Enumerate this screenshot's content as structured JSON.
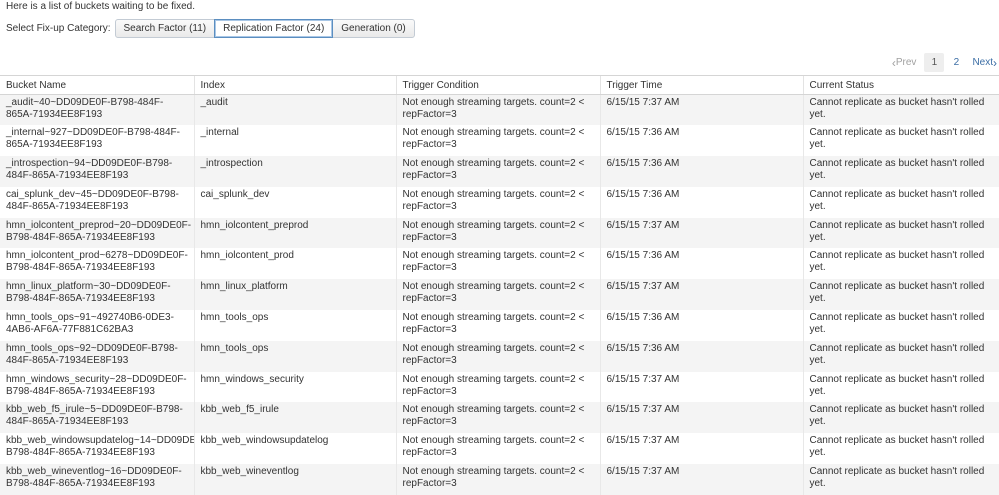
{
  "intro_text": "Here is a list of buckets waiting to be fixed.",
  "category": {
    "label": "Select Fix-up Category:",
    "buttons": [
      {
        "label": "Search Factor (11)",
        "active": false
      },
      {
        "label": "Replication Factor (24)",
        "active": true
      },
      {
        "label": "Generation (0)",
        "active": false
      }
    ]
  },
  "pagination": {
    "prev_label": "Prev",
    "pages": [
      "1",
      "2"
    ],
    "current_page": "1",
    "next_label": "Next"
  },
  "table": {
    "headers": [
      "Bucket Name",
      "Index",
      "Trigger Condition",
      "Trigger Time",
      "Current Status"
    ],
    "rows": [
      [
        "_audit~40~DD09DE0F-B798-484F-865A-71934EE8F193",
        "_audit",
        "Not enough streaming targets. count=2 < repFactor=3",
        "6/15/15 7:37 AM",
        "Cannot replicate as bucket hasn't rolled yet."
      ],
      [
        "_internal~927~DD09DE0F-B798-484F-865A-71934EE8F193",
        "_internal",
        "Not enough streaming targets. count=2 < repFactor=3",
        "6/15/15 7:36 AM",
        "Cannot replicate as bucket hasn't rolled yet."
      ],
      [
        "_introspection~94~DD09DE0F-B798-484F-865A-71934EE8F193",
        "_introspection",
        "Not enough streaming targets. count=2 < repFactor=3",
        "6/15/15 7:36 AM",
        "Cannot replicate as bucket hasn't rolled yet."
      ],
      [
        "cai_splunk_dev~45~DD09DE0F-B798-484F-865A-71934EE8F193",
        "cai_splunk_dev",
        "Not enough streaming targets. count=2 < repFactor=3",
        "6/15/15 7:36 AM",
        "Cannot replicate as bucket hasn't rolled yet."
      ],
      [
        "hmn_iolcontent_preprod~20~DD09DE0F-B798-484F-865A-71934EE8F193",
        "hmn_iolcontent_preprod",
        "Not enough streaming targets. count=2 < repFactor=3",
        "6/15/15 7:37 AM",
        "Cannot replicate as bucket hasn't rolled yet."
      ],
      [
        "hmn_iolcontent_prod~6278~DD09DE0F-B798-484F-865A-71934EE8F193",
        "hmn_iolcontent_prod",
        "Not enough streaming targets. count=2 < repFactor=3",
        "6/15/15 7:36 AM",
        "Cannot replicate as bucket hasn't rolled yet."
      ],
      [
        "hmn_linux_platform~30~DD09DE0F-B798-484F-865A-71934EE8F193",
        "hmn_linux_platform",
        "Not enough streaming targets. count=2 < repFactor=3",
        "6/15/15 7:37 AM",
        "Cannot replicate as bucket hasn't rolled yet."
      ],
      [
        "hmn_tools_ops~91~492740B6-0DE3-4AB6-AF6A-77F881C62BA3",
        "hmn_tools_ops",
        "Not enough streaming targets. count=2 < repFactor=3",
        "6/15/15 7:36 AM",
        "Cannot replicate as bucket hasn't rolled yet."
      ],
      [
        "hmn_tools_ops~92~DD09DE0F-B798-484F-865A-71934EE8F193",
        "hmn_tools_ops",
        "Not enough streaming targets. count=2 < repFactor=3",
        "6/15/15 7:36 AM",
        "Cannot replicate as bucket hasn't rolled yet."
      ],
      [
        "hmn_windows_security~28~DD09DE0F-B798-484F-865A-71934EE8F193",
        "hmn_windows_security",
        "Not enough streaming targets. count=2 < repFactor=3",
        "6/15/15 7:37 AM",
        "Cannot replicate as bucket hasn't rolled yet."
      ],
      [
        "kbb_web_f5_irule~5~DD09DE0F-B798-484F-865A-71934EE8F193",
        "kbb_web_f5_irule",
        "Not enough streaming targets. count=2 < repFactor=3",
        "6/15/15 7:37 AM",
        "Cannot replicate as bucket hasn't rolled yet."
      ],
      [
        "kbb_web_windowsupdatelog~14~DD09DE0F-B798-484F-865A-71934EE8F193",
        "kbb_web_windowsupdatelog",
        "Not enough streaming targets. count=2 < repFactor=3",
        "6/15/15 7:37 AM",
        "Cannot replicate as bucket hasn't rolled yet."
      ],
      [
        "kbb_web_wineventlog~16~DD09DE0F-B798-484F-865A-71934EE8F193",
        "kbb_web_wineventlog",
        "Not enough streaming targets. count=2 < repFactor=3",
        "6/15/15 7:37 AM",
        "Cannot replicate as bucket hasn't rolled yet."
      ]
    ]
  }
}
